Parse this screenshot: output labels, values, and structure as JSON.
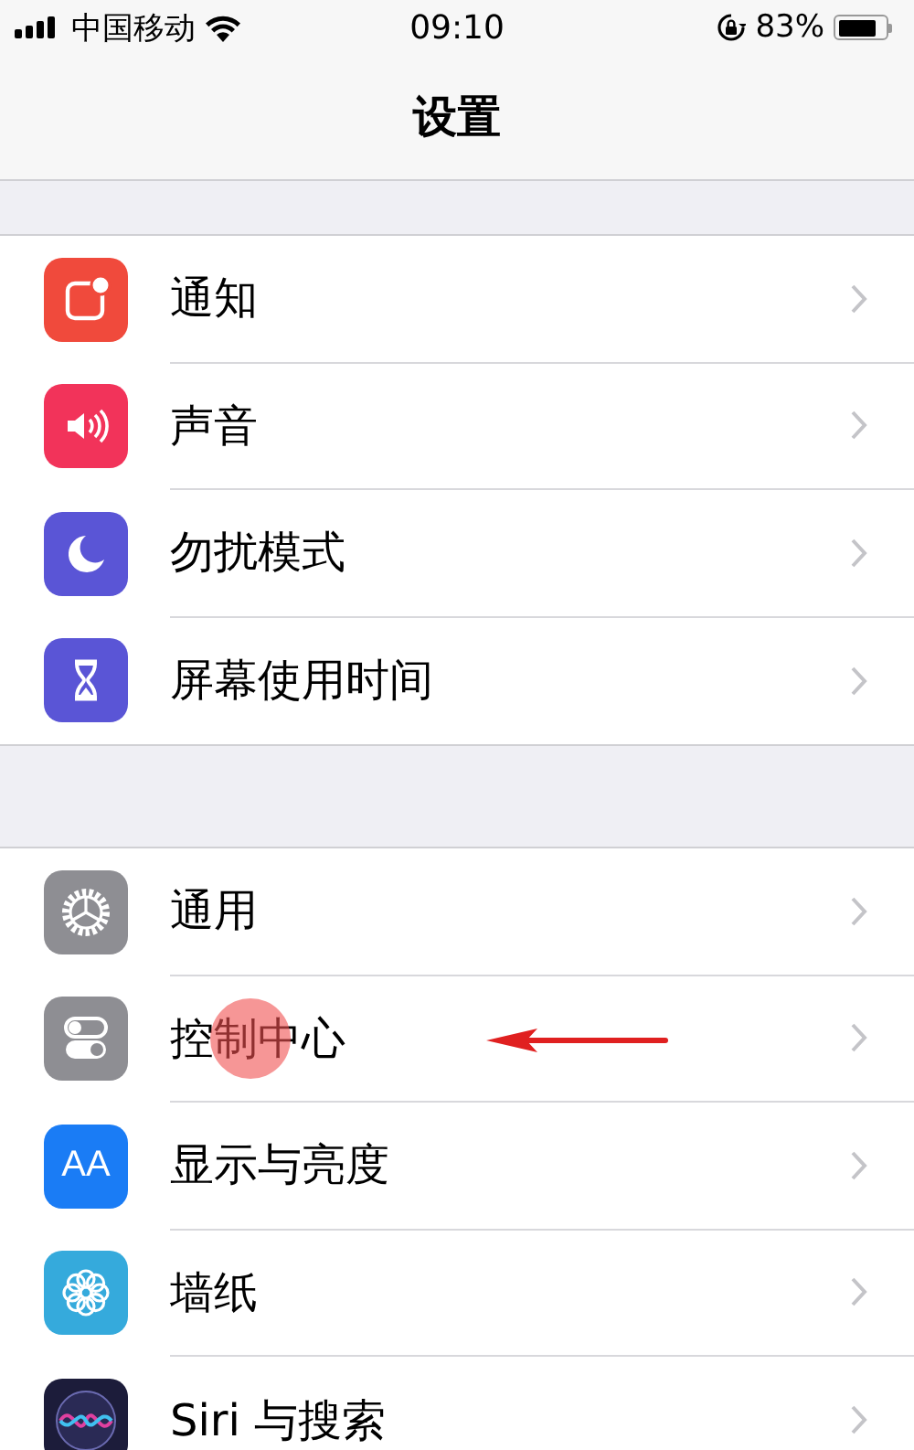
{
  "status_bar": {
    "carrier": "中国移动",
    "time": "09:10",
    "battery_text": "83%",
    "battery": {
      "level": 0.83
    }
  },
  "nav": {
    "title": "设置"
  },
  "groups": [
    {
      "items": [
        {
          "label": "通知",
          "kind": "notification",
          "color": "#f04a3c",
          "tapped": false
        },
        {
          "label": "声音",
          "kind": "sound",
          "color": "#f2335a",
          "tapped": false
        },
        {
          "label": "勿扰模式",
          "kind": "moon",
          "color": "#5a55d6",
          "tapped": false
        },
        {
          "label": "屏幕使用时间",
          "kind": "hourglass",
          "color": "#5a55d6",
          "tapped": false
        }
      ]
    },
    {
      "items": [
        {
          "label": "通用",
          "kind": "gear",
          "color": "#8e8e93",
          "tapped": false
        },
        {
          "label": "控制中心",
          "kind": "switches",
          "color": "#8e8e93",
          "tapped": true
        },
        {
          "label": "显示与亮度",
          "kind": "text-size",
          "glyph": "AA",
          "color": "#1a7cf5",
          "tapped": false
        },
        {
          "label": "墙纸",
          "kind": "flower",
          "color": "#35aadc",
          "tapped": false
        },
        {
          "label": "Siri 与搜索",
          "kind": "siri",
          "color": "#1c1c3a",
          "tapped": false
        }
      ]
    }
  ]
}
